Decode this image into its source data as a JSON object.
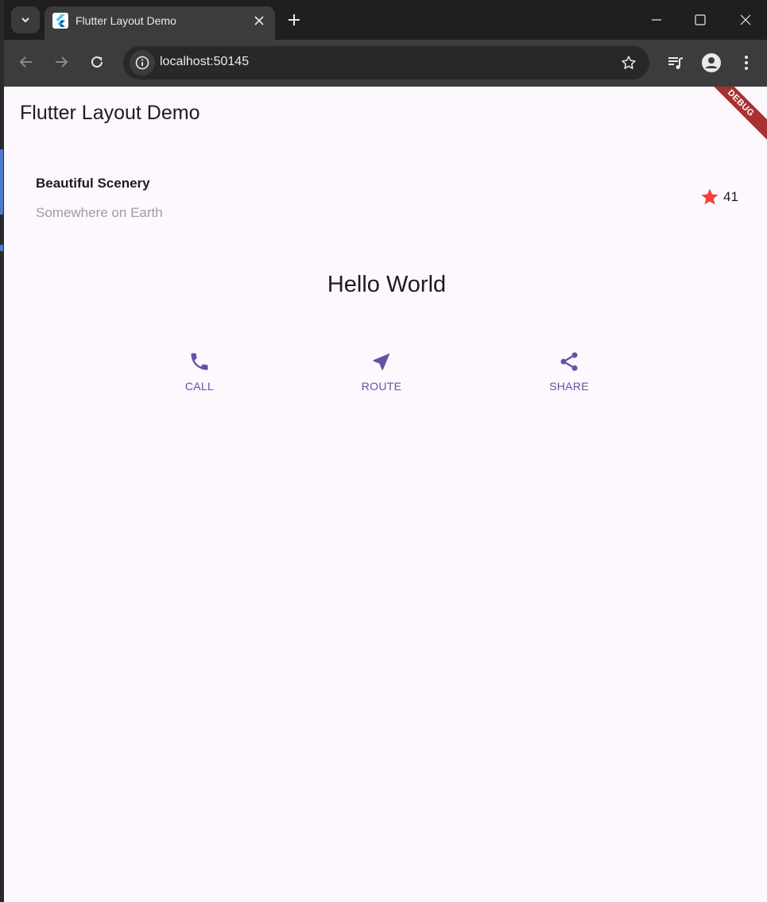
{
  "browser": {
    "tab_title": "Flutter Layout Demo",
    "url": "localhost:50145"
  },
  "app": {
    "title": "Flutter Layout Demo",
    "debug_banner": "DEBUG",
    "place": {
      "name": "Beautiful Scenery",
      "location": "Somewhere on Earth",
      "rating_count": "41"
    },
    "greeting": "Hello World",
    "actions": [
      {
        "label": "CALL",
        "icon": "phone-icon"
      },
      {
        "label": "ROUTE",
        "icon": "navigation-icon"
      },
      {
        "label": "SHARE",
        "icon": "share-icon"
      }
    ]
  },
  "colors": {
    "accent": "#6750a4",
    "star": "#f44336",
    "background": "#fdf7fe"
  }
}
